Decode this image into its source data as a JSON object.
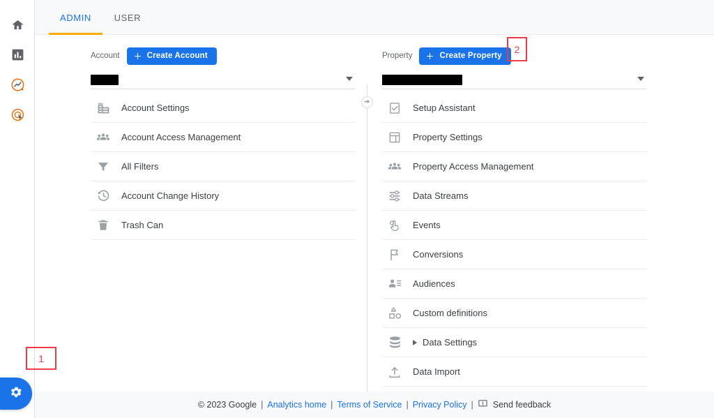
{
  "rail": {
    "items": [
      {
        "name": "home-icon",
        "label": "Home"
      },
      {
        "name": "reports-icon",
        "label": "Reports"
      },
      {
        "name": "explore-icon",
        "label": "Explore"
      },
      {
        "name": "advertising-icon",
        "label": "Advertising"
      }
    ],
    "admin_button": {
      "name": "gear-icon",
      "label": "Admin"
    }
  },
  "tabs": [
    {
      "label": "ADMIN",
      "active": true
    },
    {
      "label": "USER",
      "active": false
    }
  ],
  "account": {
    "label": "Account",
    "create_label": "Create Account",
    "selected_value": "",
    "items": [
      {
        "icon": "building-icon",
        "label": "Account Settings"
      },
      {
        "icon": "people-icon",
        "label": "Account Access Management"
      },
      {
        "icon": "filter-icon",
        "label": "All Filters"
      },
      {
        "icon": "history-icon",
        "label": "Account Change History"
      },
      {
        "icon": "trash-icon",
        "label": "Trash Can"
      }
    ]
  },
  "property": {
    "label": "Property",
    "create_label": "Create Property",
    "selected_value": "",
    "items": [
      {
        "icon": "checklist-icon",
        "label": "Setup Assistant",
        "expandable": false
      },
      {
        "icon": "layout-icon",
        "label": "Property Settings",
        "expandable": false
      },
      {
        "icon": "people-icon",
        "label": "Property Access Management",
        "expandable": false
      },
      {
        "icon": "tune-icon",
        "label": "Data Streams",
        "expandable": false
      },
      {
        "icon": "touch-icon",
        "label": "Events",
        "expandable": false
      },
      {
        "icon": "flag-icon",
        "label": "Conversions",
        "expandable": false
      },
      {
        "icon": "audience-icon",
        "label": "Audiences",
        "expandable": false
      },
      {
        "icon": "shapes-icon",
        "label": "Custom definitions",
        "expandable": false
      },
      {
        "icon": "database-icon",
        "label": "Data Settings",
        "expandable": true
      },
      {
        "icon": "upload-icon",
        "label": "Data Import",
        "expandable": false
      }
    ]
  },
  "footer": {
    "copyright": "© 2023 Google",
    "analytics_home": "Analytics home",
    "terms": "Terms of Service",
    "privacy": "Privacy Policy",
    "feedback": "Send feedback",
    "separator": "|"
  },
  "annotations": [
    {
      "id": "1",
      "text": "1"
    },
    {
      "id": "2",
      "text": "2"
    }
  ],
  "colors": {
    "accent_blue": "#1a73e8",
    "tab_underline": "#f9ab00",
    "annotation_red": "#ef3b48",
    "text_primary": "#3c4043",
    "text_secondary": "#5f6368"
  }
}
